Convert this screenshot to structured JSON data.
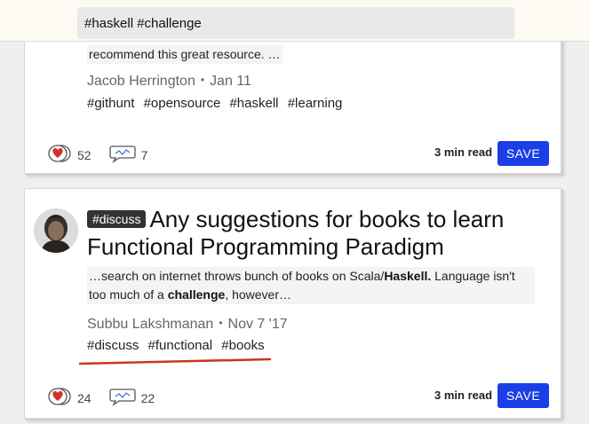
{
  "search": {
    "value": "#haskell #challenge"
  },
  "posts": [
    {
      "snippet": "recommend this great resource. …",
      "author": "Jacob Herrington",
      "date": "Jan 11",
      "tags": [
        "#githunt",
        "#opensource",
        "#haskell",
        "#learning"
      ],
      "reactions": "52",
      "comments": "7",
      "read_time": "3 min read",
      "save_label": "SAVE"
    },
    {
      "tag_chip": "#discuss",
      "title": "Any suggestions for books to learn Functional Programming Paradigm",
      "snippet_parts": [
        {
          "text": "…search on internet throws bunch of books on Scala/",
          "bold": false
        },
        {
          "text": "Haskell.",
          "bold": true
        },
        {
          "text": " Language isn't too much of a ",
          "bold": false
        },
        {
          "text": "challenge",
          "bold": true
        },
        {
          "text": ", however…",
          "bold": false
        }
      ],
      "author": "Subbu Lakshmanan",
      "date": "Nov 7 '17",
      "tags": [
        "#discuss",
        "#functional",
        "#books"
      ],
      "reactions": "24",
      "comments": "22",
      "read_time": "3 min read",
      "save_label": "SAVE"
    }
  ],
  "colors": {
    "accent": "#1a3ee8",
    "heart": "#d0342c",
    "annotation": "#c8361f"
  },
  "icons": {
    "reaction": "heart-icon",
    "comment": "comment-icon"
  }
}
